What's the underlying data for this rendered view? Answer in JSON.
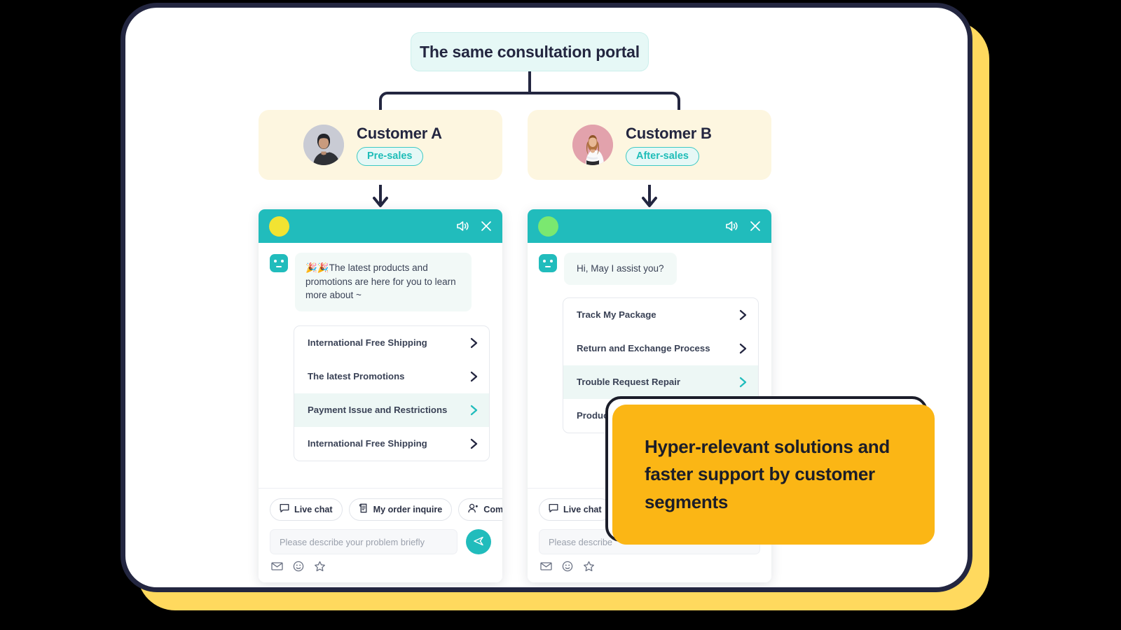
{
  "theme": {
    "teal": "#21BCBC",
    "navy": "#232640",
    "yellow_shadow": "#FFD95E",
    "callout_yellow": "#FBB615",
    "card_cream": "#FDF6E0",
    "portal_mint": "#E6F8F6"
  },
  "flow": {
    "root_label": "The same consultation portal"
  },
  "customers": [
    {
      "name": "Customer A",
      "segment": "Pre-sales",
      "avatar": "male-avatar"
    },
    {
      "name": "Customer B",
      "segment": "After-sales",
      "avatar": "female-avatar"
    }
  ],
  "chats": [
    {
      "id": "chat-customer-a",
      "status_dot": "yellow",
      "header_icons": [
        "speaker-icon",
        "close-icon"
      ],
      "greeting": "🎉🎉The latest products and promotions are here for you to learn more about ~",
      "menu": [
        {
          "label": "International Free Shipping",
          "active": false
        },
        {
          "label": "The latest Promotions",
          "active": false
        },
        {
          "label": "Payment Issue and Restrictions",
          "active": true
        },
        {
          "label": "International Free Shipping",
          "active": false
        }
      ],
      "chips": [
        {
          "label": "Live chat",
          "icon": "chat-bubble-icon"
        },
        {
          "label": "My order inquire",
          "icon": "order-doc-icon"
        },
        {
          "label": "Compl",
          "icon": "person-search-icon"
        }
      ],
      "input_placeholder": "Please describe your problem briefly",
      "send_icon": "send-plane-icon",
      "foot_icons": [
        "envelope-icon",
        "emoji-icon",
        "star-icon"
      ]
    },
    {
      "id": "chat-customer-b",
      "status_dot": "green",
      "header_icons": [
        "speaker-icon",
        "close-icon"
      ],
      "greeting": "Hi, May I assist you?",
      "menu": [
        {
          "label": "Track My Package",
          "active": false
        },
        {
          "label": "Return and Exchange Process",
          "active": false
        },
        {
          "label": "Trouble Request Repair",
          "active": true
        },
        {
          "label": "Product",
          "active": false
        }
      ],
      "chips": [
        {
          "label": "Live chat",
          "icon": "chat-bubble-icon"
        }
      ],
      "input_placeholder": "Please describe",
      "send_icon": "send-plane-icon",
      "foot_icons": [
        "envelope-icon",
        "emoji-icon",
        "star-icon"
      ]
    }
  ],
  "callout": {
    "text": "Hyper-relevant solutions and faster support by customer segments"
  }
}
